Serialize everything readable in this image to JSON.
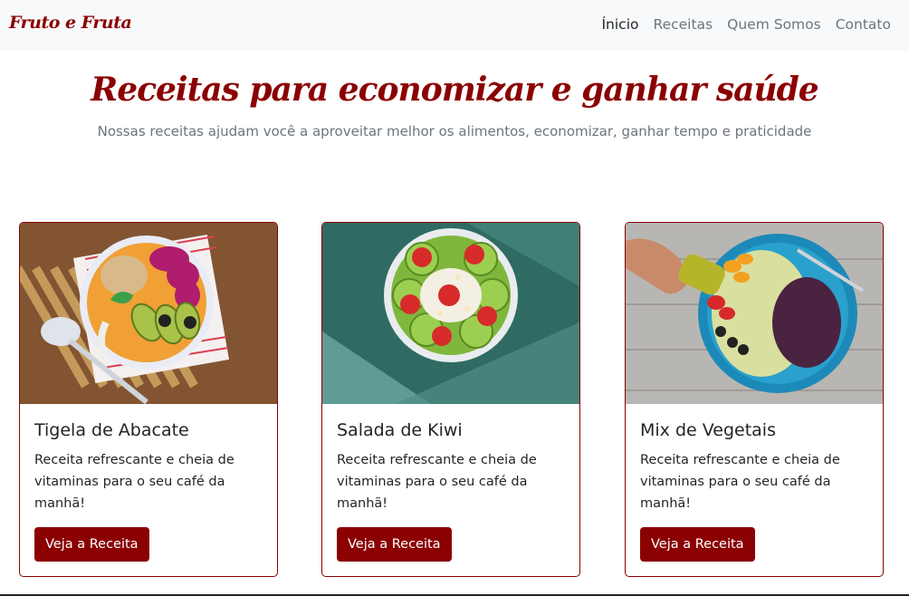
{
  "navbar": {
    "brand": "Fruto e Fruta",
    "links": [
      "Ínicio",
      "Receitas",
      "Quem Somos",
      "Contato"
    ]
  },
  "hero": {
    "title": "Receitas para economizar e ganhar saúde",
    "subtitle": "Nossas receitas ajudam você a aproveitar melhor os alimentos, economizar, ganhar tempo e praticidade"
  },
  "cards": [
    {
      "title": "Tigela de Abacate",
      "text": "Receita refrescante e cheia de vitaminas para o seu café da manhã!",
      "button": "Veja a Receita"
    },
    {
      "title": "Salada de Kiwi",
      "text": "Receita refrescante e cheia de vitaminas para o seu café da manhã!",
      "button": "Veja a Receita"
    },
    {
      "title": "Mix de Vegetais",
      "text": "Receita refrescante e cheia de vitaminas para o seu café da manhã!",
      "button": "Veja a Receita"
    }
  ],
  "colors": {
    "accent": "#8b0000",
    "navbar_bg": "#f8f9fa",
    "muted": "#6c757d"
  }
}
